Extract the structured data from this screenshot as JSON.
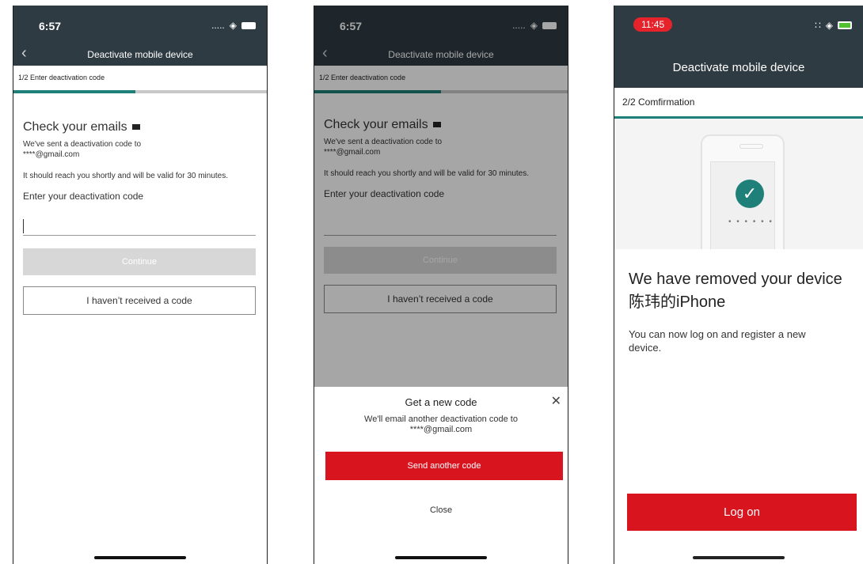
{
  "screen1": {
    "time": "6:57",
    "status_dots": ".....",
    "nav_title": "Deactivate mobile device",
    "step_label": "1/2 Enter deactivation code",
    "heading": "Check your emails",
    "sent_to_line1": "We've sent a deactivation code to",
    "sent_to_line2": "****@gmail.com",
    "validity": "It should reach you shortly and will be valid for 30 minutes.",
    "input_label": "Enter your deactivation code",
    "input_value": "",
    "continue_label": "Continue",
    "not_received_label": "I haven’t received a code"
  },
  "screen2": {
    "time": "6:57",
    "status_dots": ".....",
    "nav_title": "Deactivate mobile device",
    "step_label": "1/2 Enter deactivation code",
    "heading": "Check your emails",
    "sent_to_line1": "We've sent a deactivation code to",
    "sent_to_line2": "****@gmail.com",
    "validity": "It should reach you shortly and will be valid for 30 minutes.",
    "input_label": "Enter your deactivation code",
    "continue_label": "Continue",
    "not_received_label": "I haven’t received a code",
    "sheet": {
      "title": "Get a new code",
      "message_line1": "We'll email another deactivation code to",
      "message_line2": "****@gmail.com",
      "send_label": "Send another code",
      "close_label": "Close"
    }
  },
  "screen3": {
    "time": "11:45",
    "nav_title": "Deactivate mobile device",
    "step_label": "2/2 Comfirmation",
    "heading_line1": "We have removed your device",
    "heading_line2": "陈玮的iPhone",
    "message": "You can now log on and register a new device.",
    "logon_label": "Log on",
    "pin_dots": "• • • • • •"
  },
  "colors": {
    "header_bg": "#2f3b42",
    "accent_teal": "#1f7f79",
    "brand_red": "#d8141f"
  },
  "progress": {
    "step1_fraction": 0.5,
    "step2_fraction": 1.0
  }
}
